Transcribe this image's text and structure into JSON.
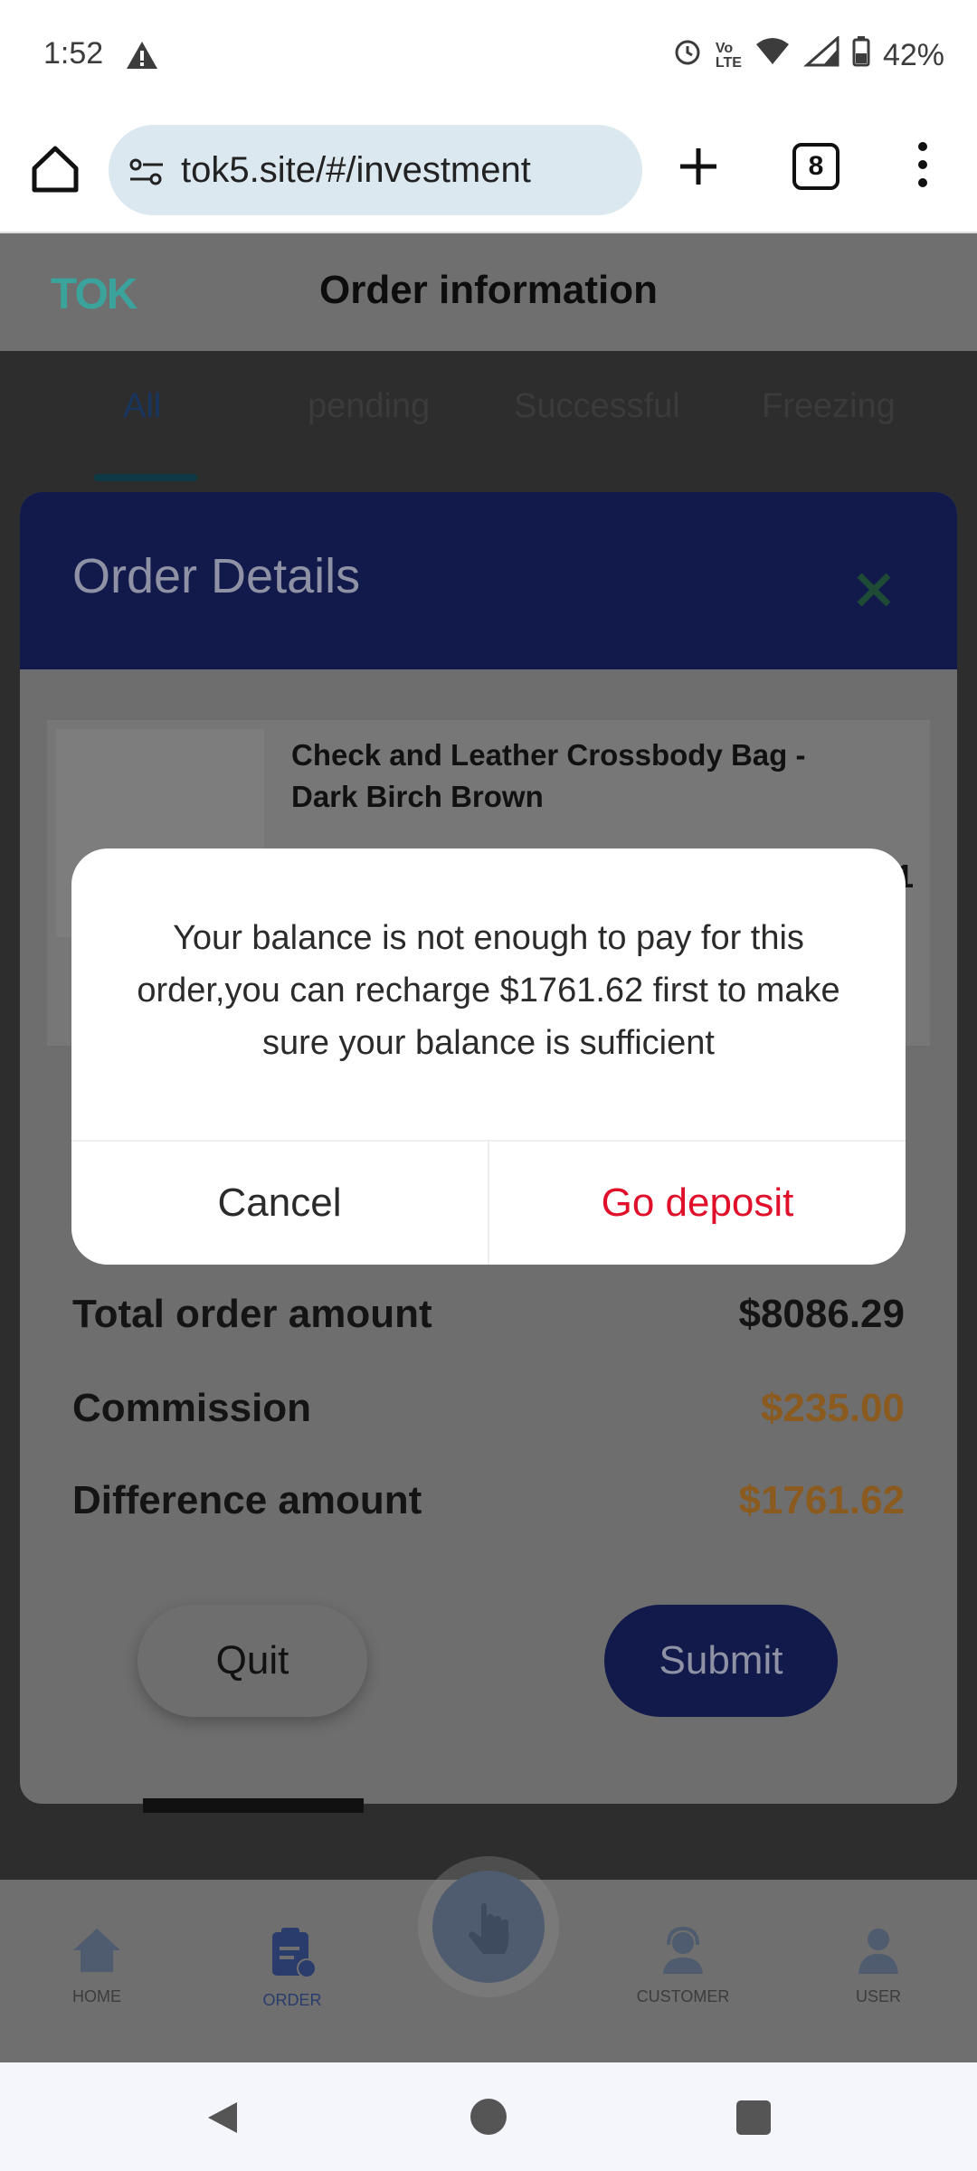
{
  "status_bar": {
    "time": "1:52",
    "battery": "42%",
    "icons": [
      "alert-icon",
      "alarm-icon",
      "volte-icon",
      "wifi-icon",
      "5g-icon",
      "signal-icon",
      "battery-icon"
    ]
  },
  "browser": {
    "url": "tok5.site/#/investment",
    "tab_count": "8"
  },
  "header": {
    "logo": "TOK",
    "title": "Order information"
  },
  "tabs": [
    {
      "label": "All"
    },
    {
      "label": "pending"
    },
    {
      "label": "Successful"
    },
    {
      "label": "Freezing"
    }
  ],
  "order_details": {
    "title": "Order Details",
    "product_name": "Check and Leather Crossbody Bag - Dark Birch Brown",
    "quantity": "1",
    "total_label": "Total order amount",
    "total_value": "$8086.29",
    "commission_label": "Commission",
    "commission_value": "$235.00",
    "difference_label": "Difference amount",
    "difference_value": "$1761.62",
    "quit_label": "Quit",
    "submit_label": "Submit"
  },
  "modal": {
    "message": "Your balance is not enough to pay for this order,you can recharge $1761.62 first to make sure your balance is sufficient",
    "cancel_label": "Cancel",
    "deposit_label": "Go deposit"
  },
  "bottom_nav": {
    "home": "HOME",
    "order": "ORDER",
    "customer": "CUSTOMER",
    "user": "USER"
  },
  "colors": {
    "accent_navy": "#111a4b",
    "deposit_red": "#e0102a",
    "amount_orange": "#8a5a1e"
  }
}
